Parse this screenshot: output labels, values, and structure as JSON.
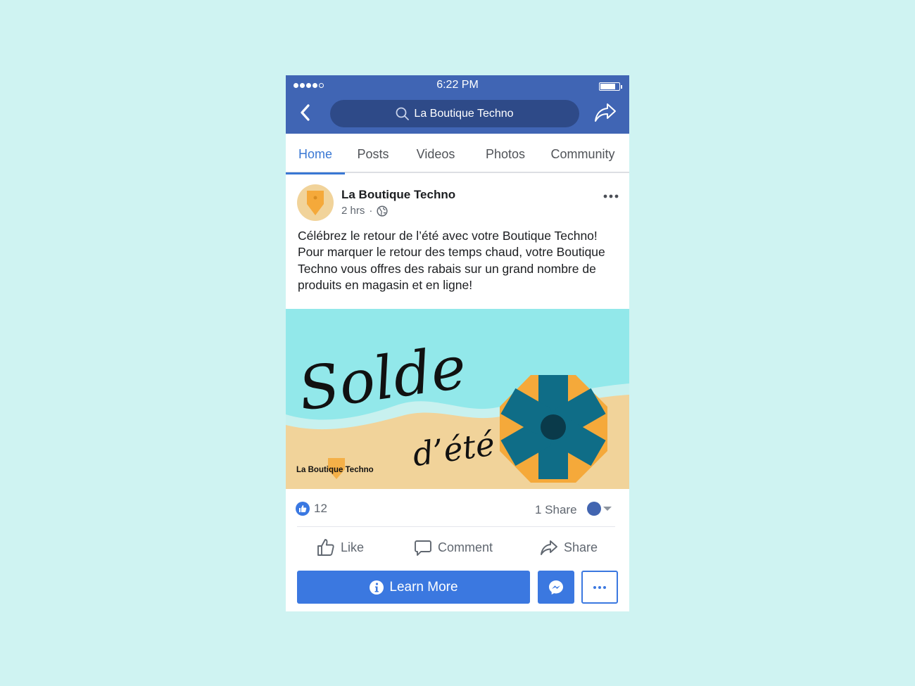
{
  "status_bar": {
    "time": "6:22 PM"
  },
  "nav": {
    "search_text": "La Boutique Techno"
  },
  "tabs": [
    {
      "label": "Home",
      "active": true
    },
    {
      "label": "Posts"
    },
    {
      "label": "Videos"
    },
    {
      "label": "Photos"
    },
    {
      "label": "Community"
    }
  ],
  "post": {
    "page_name": "La Boutique Techno",
    "time": "2 hrs",
    "separator": "·",
    "text": "Célébrez le retour de l’été avec votre Boutique Techno! Pour marquer le retour des temps chaud, votre Boutique Techno vous offres des rabais sur un grand nombre de produits en magasin et en ligne!",
    "image": {
      "headline": "Solde",
      "subline": "d’été",
      "brand": "La Boutique Techno"
    },
    "like_count": "12",
    "share_count": "1 Share"
  },
  "actions": {
    "like": "Like",
    "comment": "Comment",
    "share": "Share"
  },
  "cta": {
    "label": "Learn More"
  },
  "colors": {
    "background": "#cff3f2",
    "nav_blue": "#4065b4",
    "accent_blue": "#3b78e0",
    "sea": "#92e8ea",
    "sand": "#f1d39a",
    "umbrella_orange": "#f5a93a",
    "umbrella_teal": "#0f6d87"
  }
}
